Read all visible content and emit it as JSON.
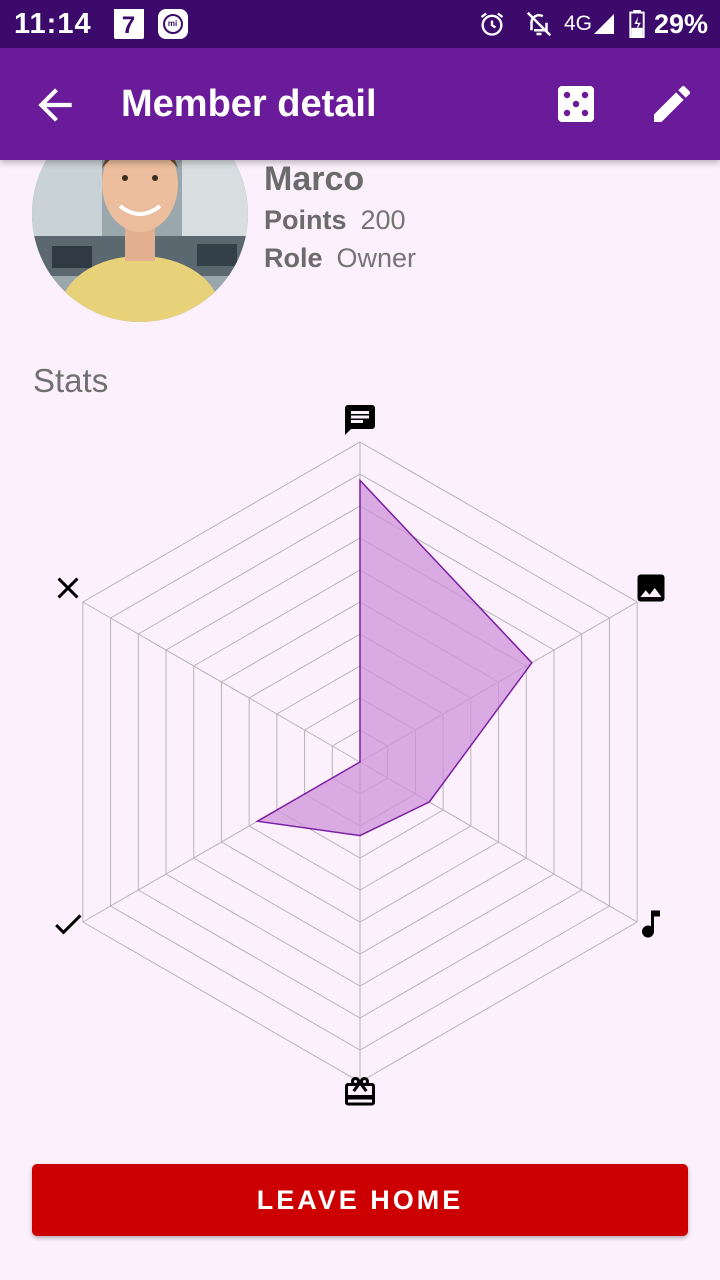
{
  "status_bar": {
    "time": "11:14",
    "calendar_day": "7",
    "mi_label": "mi",
    "network": "4G",
    "battery": "29%"
  },
  "app_bar": {
    "title": "Member detail",
    "icons": [
      "arrow-back-icon",
      "dice-icon",
      "edit-icon"
    ]
  },
  "member": {
    "name": "Marco",
    "points_label": "Points",
    "points_value": "200",
    "role_label": "Role",
    "role_value": "Owner"
  },
  "stats": {
    "title": "Stats"
  },
  "chart_data": {
    "type": "radar",
    "axes": [
      "chat",
      "image",
      "music",
      "gift",
      "check",
      "close"
    ],
    "axis_icons": [
      "chat-icon",
      "image-icon",
      "music-note-icon",
      "gift-card-icon",
      "check-icon",
      "close-icon"
    ],
    "values": [
      0.88,
      0.62,
      0.25,
      0.23,
      0.37,
      0.0
    ],
    "max": 1,
    "grid_levels": 10,
    "fill_color": "#ce93d8",
    "stroke_color": "#7b1fa2"
  },
  "actions": {
    "leave_label": "LEAVE HOME"
  },
  "colors": {
    "app_bar": "#6a1b9a",
    "status_bar": "#3c0a6b",
    "background": "#fdf0fd",
    "leave_button": "#cc0000"
  }
}
